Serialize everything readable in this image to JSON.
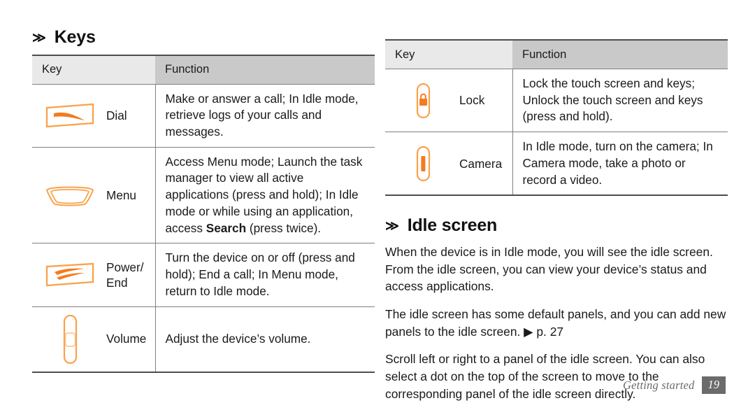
{
  "colors": {
    "accent_orange": "#F68B1F",
    "header_key_bg": "#E9E9E9",
    "header_function_bg": "#C9C9C9",
    "rule_dark": "#4D4D4D",
    "rule_light": "#808080",
    "footer_gray": "#6B6B6B",
    "text": "#1A1A1A"
  },
  "left_column": {
    "heading": {
      "chevron": "≫",
      "title": "Keys"
    },
    "table": {
      "columns": [
        "Key",
        "Function"
      ],
      "rows": [
        {
          "icon": "dial-key-icon",
          "key_label": "Dial",
          "function_parts": [
            {
              "text": "Make or answer a call; In Idle mode, retrieve logs of your calls and messages.",
              "bold": false
            }
          ]
        },
        {
          "icon": "menu-key-icon",
          "key_label": "Menu",
          "function_parts": [
            {
              "text": "Access Menu mode; Launch the task manager to view all active applications (press and hold); In Idle mode or while using an application, access ",
              "bold": false
            },
            {
              "text": "Search",
              "bold": true
            },
            {
              "text": " (press twice).",
              "bold": false
            }
          ]
        },
        {
          "icon": "power-end-key-icon",
          "key_label": "Power/ End",
          "function_parts": [
            {
              "text": "Turn the device on or off (press and hold); End a call; In Menu mode, return to Idle mode.",
              "bold": false
            }
          ]
        },
        {
          "icon": "volume-key-icon",
          "key_label": "Volume",
          "function_parts": [
            {
              "text": "Adjust the device’s volume.",
              "bold": false
            }
          ]
        }
      ]
    }
  },
  "right_column": {
    "table": {
      "columns": [
        "Key",
        "Function"
      ],
      "rows": [
        {
          "icon": "lock-key-icon",
          "key_label": "Lock",
          "function_parts": [
            {
              "text": "Lock the touch screen and keys; Unlock the touch screen and keys (press and hold).",
              "bold": false
            }
          ]
        },
        {
          "icon": "camera-key-icon",
          "key_label": "Camera",
          "function_parts": [
            {
              "text": "In Idle mode, turn on the camera; In Camera mode, take a photo or record a video.",
              "bold": false
            }
          ]
        }
      ]
    },
    "heading": {
      "chevron": "≫",
      "title": "Idle screen"
    },
    "paragraphs": [
      {
        "text": "When the device is in Idle mode, you will see the idle screen. From the idle screen, you can view your device’s status and access applications."
      },
      {
        "text": "The idle screen has some default panels, and you can add new panels to the idle screen. ▶ p. 27"
      },
      {
        "text": "Scroll left or right to a panel of the idle screen. You can also select a dot on the top of the screen to move to the corresponding panel of the idle screen directly."
      }
    ]
  },
  "footer": {
    "label": "Getting started",
    "page_number": "19"
  }
}
